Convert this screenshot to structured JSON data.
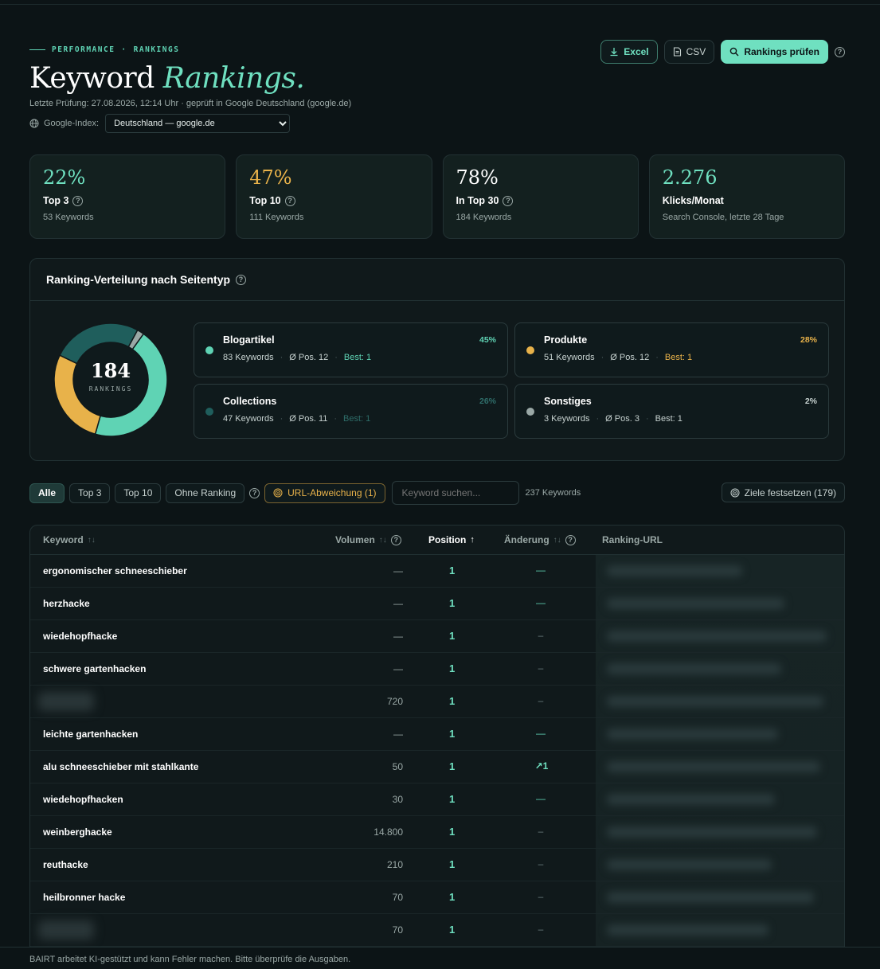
{
  "header": {
    "eyebrow_section": "PERFORMANCE",
    "eyebrow_sep": "·",
    "eyebrow_page": "RANKINGS",
    "title_main": "Keyword",
    "title_accent": "Rankings.",
    "last_check": "Letzte Prüfung: 27.08.2026, 12:14 Uhr · geprüft in Google Deutschland (google.de)",
    "index_label": "Google-Index:",
    "index_selected": "Deutschland — google.de"
  },
  "actions": {
    "excel_label": "Excel",
    "csv_label": "CSV",
    "check_label": "Rankings prüfen",
    "help_glyph": "?"
  },
  "kpis": [
    {
      "value": "22%",
      "label": "Top 3",
      "sub": "53 Keywords",
      "color": "#6fe0c0",
      "help": true
    },
    {
      "value": "47%",
      "label": "Top 10",
      "sub": "111 Keywords",
      "color": "#e8b24a",
      "help": true
    },
    {
      "value": "78%",
      "label": "In Top 30",
      "sub": "184 Keywords",
      "color": "#ffffff",
      "help": true
    },
    {
      "value": "2.276",
      "label": "Klicks/Monat",
      "sub": "Search Console, letzte 28 Tage",
      "color": "#6fe0c0",
      "help": false
    }
  ],
  "distribution": {
    "title": "Ranking-Verteilung nach Seitentyp",
    "total": "184",
    "total_label": "RANKINGS",
    "segments": [
      {
        "name": "Blogartikel",
        "pct": "45%",
        "share": 45,
        "keywords": "83 Keywords",
        "avg": "Ø Pos. 12",
        "best": "Best: 1",
        "color": "#5fd3b4",
        "accent": "#5fd3b4"
      },
      {
        "name": "Produkte",
        "pct": "28%",
        "share": 28,
        "keywords": "51 Keywords",
        "avg": "Ø Pos. 12",
        "best": "Best: 1",
        "color": "#e8b24a",
        "accent": "#e8b24a"
      },
      {
        "name": "Collections",
        "pct": "26%",
        "share": 26,
        "keywords": "47 Keywords",
        "avg": "Ø Pos. 11",
        "best": "Best: 1",
        "color": "#1f5e5c",
        "accent": "#2f6e6a"
      },
      {
        "name": "Sonstiges",
        "pct": "2%",
        "share": 2,
        "keywords": "3 Keywords",
        "avg": "Ø Pos. 3",
        "best": "Best: 1",
        "color": "#9aa8a6",
        "accent": "#c7d2d0"
      }
    ]
  },
  "filters": {
    "chips": [
      "Alle",
      "Top 3",
      "Top 10",
      "Ohne Ranking"
    ],
    "url_deviation": "URL-Abweichung (1)",
    "search_placeholder": "Keyword suchen...",
    "keyword_count": "237 Keywords",
    "goals": "Ziele festsetzen (179)"
  },
  "table": {
    "columns": {
      "keyword": "Keyword",
      "volume": "Volumen",
      "position": "Position",
      "change": "Änderung",
      "url": "Ranking-URL"
    },
    "rows": [
      {
        "keyword": "ergonomischer schneeschieber",
        "volume": "—",
        "position": "1",
        "change": "—",
        "change_style": "teal"
      },
      {
        "keyword": "herzhacke",
        "volume": "—",
        "position": "1",
        "change": "—",
        "change_style": "teal"
      },
      {
        "keyword": "wiedehopfhacke",
        "volume": "—",
        "position": "1",
        "change": "–",
        "change_style": "muted"
      },
      {
        "keyword": "schwere gartenhacken",
        "volume": "—",
        "position": "1",
        "change": "–",
        "change_style": "muted"
      },
      {
        "keyword": "",
        "volume": "720",
        "position": "1",
        "change": "–",
        "change_style": "muted"
      },
      {
        "keyword": "leichte gartenhacken",
        "volume": "—",
        "position": "1",
        "change": "—",
        "change_style": "teal"
      },
      {
        "keyword": "alu schneeschieber mit stahlkante",
        "volume": "50",
        "position": "1",
        "change": "↗1",
        "change_style": "up"
      },
      {
        "keyword": "wiedehopfhacken",
        "volume": "30",
        "position": "1",
        "change": "—",
        "change_style": "teal"
      },
      {
        "keyword": "weinberghacke",
        "volume": "14.800",
        "position": "1",
        "change": "–",
        "change_style": "muted"
      },
      {
        "keyword": "reuthacke",
        "volume": "210",
        "position": "1",
        "change": "–",
        "change_style": "muted"
      },
      {
        "keyword": "heilbronner hacke",
        "volume": "70",
        "position": "1",
        "change": "–",
        "change_style": "muted"
      },
      {
        "keyword": "",
        "volume": "70",
        "position": "1",
        "change": "–",
        "change_style": "muted"
      }
    ]
  },
  "footer": {
    "disclaimer": "BAIRT arbeitet KI-gestützt und kann Fehler machen. Bitte überprüfe die Ausgaben."
  }
}
